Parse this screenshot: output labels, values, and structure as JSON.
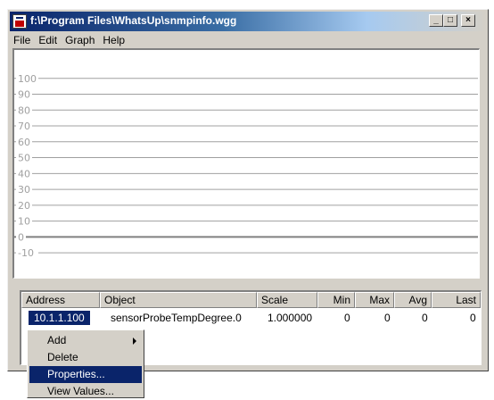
{
  "window": {
    "title": "f:\\Program Files\\WhatsUp\\snmpinfo.wgg",
    "buttons": {
      "minimize": "_",
      "maximize": "□",
      "close": "×"
    }
  },
  "menu": [
    "File",
    "Edit",
    "Graph",
    "Help"
  ],
  "chart_data": {
    "type": "line",
    "title": "",
    "xlabel": "",
    "ylabel": "",
    "ylim": [
      -15,
      110
    ],
    "grid": true,
    "y_ticks": [
      "100",
      "90",
      "80",
      "70",
      "60",
      "50",
      "40",
      "30",
      "20",
      "10",
      "0",
      "-10"
    ],
    "series": [
      {
        "values": []
      }
    ]
  },
  "table": {
    "columns": [
      "Address",
      "Object",
      "Scale",
      "Min",
      "Max",
      "Avg",
      "Last"
    ],
    "rows": [
      [
        "10.1.1.100",
        "sensorProbeTempDegree.0",
        "1.000000",
        "0",
        "0",
        "0",
        "0"
      ]
    ]
  },
  "context_menu": {
    "items": [
      "Add",
      "Delete",
      "Properties...",
      "View Values..."
    ],
    "highlighted": "Properties..."
  },
  "colors": {
    "title_active": "#0a246a",
    "face": "#d4d0c8",
    "gridline": "#a0a0a0"
  }
}
